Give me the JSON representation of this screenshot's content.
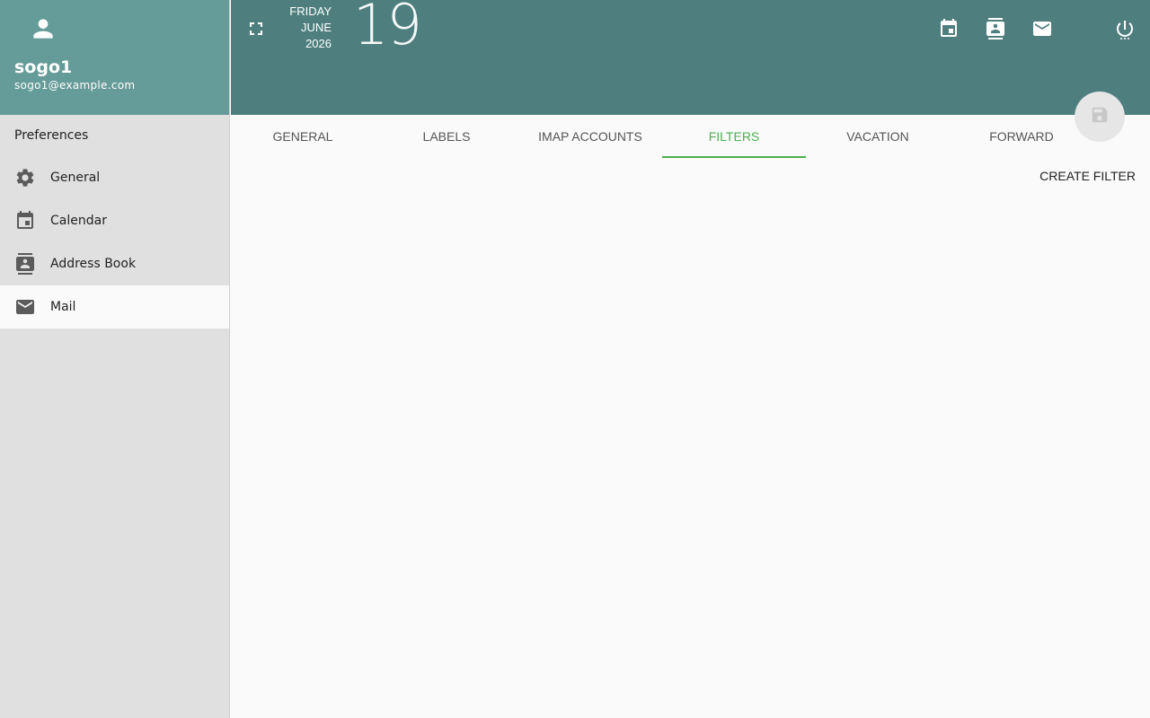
{
  "user": {
    "name": "sogo1",
    "email": "sogo1@example.com",
    "avatar_icon": "person-icon"
  },
  "sidebar": {
    "header": "Preferences",
    "items": [
      {
        "label": "General",
        "icon": "gear-icon",
        "active": false
      },
      {
        "label": "Calendar",
        "icon": "calendar-icon",
        "active": false
      },
      {
        "label": "Address Book",
        "icon": "contacts-icon",
        "active": false
      },
      {
        "label": "Mail",
        "icon": "mail-icon",
        "active": true
      }
    ]
  },
  "date": {
    "weekday": "FRIDAY",
    "month": "JUNE",
    "year": "2026",
    "day": "19"
  },
  "topbar_icons": [
    "fullscreen-icon",
    "calendar-icon",
    "contacts-icon",
    "mail-icon",
    "power-icon"
  ],
  "tabs": [
    {
      "label": "General",
      "active": false
    },
    {
      "label": "Labels",
      "active": false
    },
    {
      "label": "IMAP Accounts",
      "active": false
    },
    {
      "label": "Filters",
      "active": true
    },
    {
      "label": "Vacation",
      "active": false
    },
    {
      "label": "Forward",
      "active": false
    }
  ],
  "main": {
    "create_filter_label": "CREATE FILTER"
  },
  "colors": {
    "sidebar_header_bg": "#659b98",
    "topbar_bg": "#4e7f7e",
    "active_tab": "#4caf50",
    "sidebar_bg": "#e0e0e0"
  }
}
